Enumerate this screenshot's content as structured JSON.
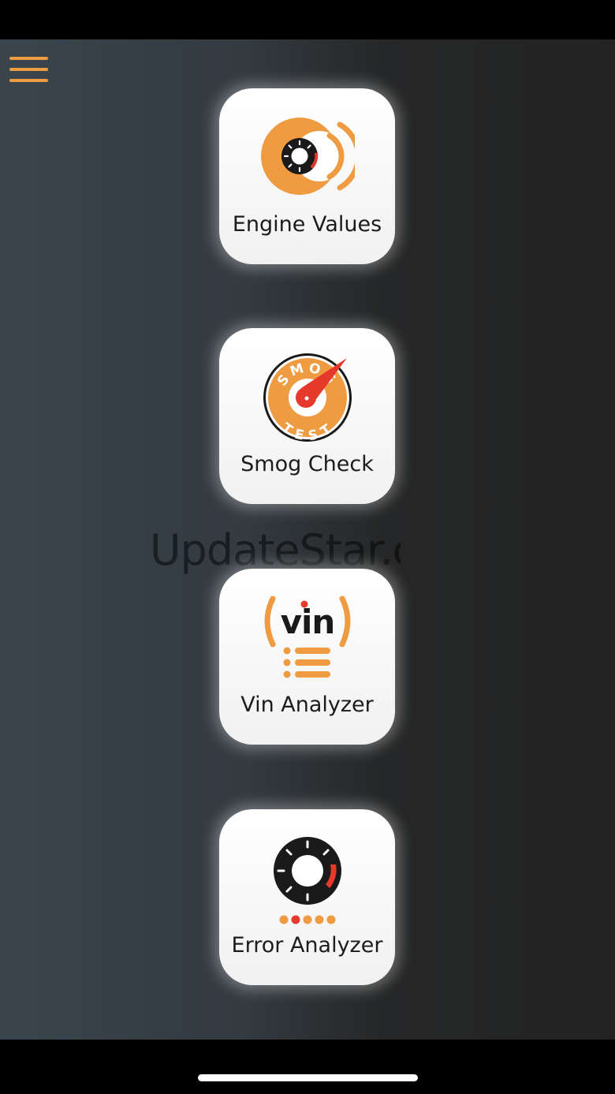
{
  "watermark": "UpdateStar.com",
  "tiles": [
    {
      "label": "Engine Values"
    },
    {
      "label": "Smog Check"
    },
    {
      "label": "Vin Analyzer"
    },
    {
      "label": "Error Analyzer"
    }
  ],
  "smog_icon": {
    "top_text": "SMOG",
    "bottom_text": "TEST"
  },
  "vin_icon": {
    "text": "vin"
  },
  "colors": {
    "accent": "#ef9b42",
    "red": "#e5392b",
    "dark": "#1a1a1a"
  }
}
